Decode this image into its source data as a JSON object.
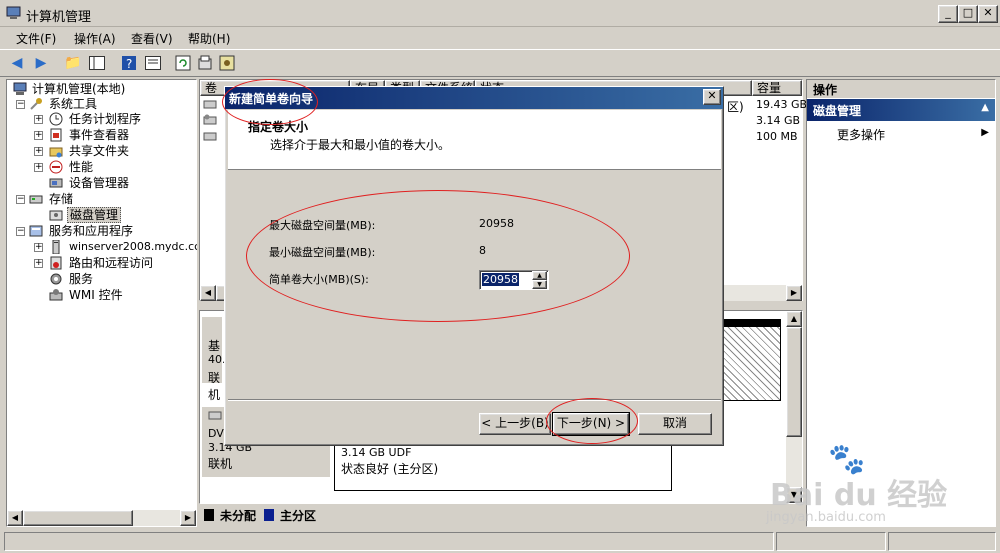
{
  "window": {
    "title": "计算机管理"
  },
  "menu": [
    "文件(F)",
    "操作(A)",
    "查看(V)",
    "帮助(H)"
  ],
  "toolbar_icons": [
    "back-arrow-icon",
    "forward-arrow-icon",
    "up-folder-icon",
    "show-tree-icon",
    "help-icon",
    "properties-icon",
    "refresh-icon",
    "export-icon",
    "settings-icon"
  ],
  "tree": {
    "root": "计算机管理(本地)",
    "system_tools": "系统工具",
    "task_scheduler": "任务计划程序",
    "event_viewer": "事件查看器",
    "shared_folders": "共享文件夹",
    "performance": "性能",
    "device_manager": "设备管理器",
    "storage": "存储",
    "disk_management": "磁盘管理",
    "services_apps": "服务和应用程序",
    "winserver": "winserver2008.mydc.cc",
    "routing": "路由和远程访问",
    "services": "服务",
    "wmi": "WMI 控件"
  },
  "list": {
    "columns": [
      "卷",
      "布局",
      "类型",
      "文件系统",
      "状态",
      "容量"
    ],
    "rows": [
      {
        "tail": "区)",
        "capacity": "19.43 GB"
      },
      {
        "tail": "",
        "capacity": "3.14 GB"
      },
      {
        "tail": "",
        "capacity": "100 MB"
      }
    ]
  },
  "disks": [
    {
      "label1": "基",
      "label2": "40.",
      "label3": "联机"
    },
    {
      "label1": "DVD",
      "label2": "3.14 GB",
      "label3": "联机",
      "partition_size": "3.14 GB UDF",
      "partition_status": "状态良好 (主分区)"
    }
  ],
  "legend": {
    "unallocated": "未分配",
    "primary": "主分区",
    "unallocated_color": "#000000",
    "primary_color": "#0a1f8f"
  },
  "actions": {
    "header": "操作",
    "section": "磁盘管理",
    "more": "更多操作"
  },
  "dialog": {
    "title": "新建简单卷向导",
    "heading": "指定卷大小",
    "subheading": "选择介于最大和最小值的卷大小。",
    "max_label": "最大磁盘空间量(MB):",
    "max_value": "20958",
    "min_label": "最小磁盘空间量(MB):",
    "min_value": "8",
    "size_label": "简单卷大小(MB)(S):",
    "size_value": "20958",
    "back_button": "< 上一步(B)",
    "next_button": "下一步(N) >",
    "cancel_button": "取消"
  },
  "watermark": {
    "brand": "Bai du 经验",
    "url": "jingyan.baidu.com"
  }
}
